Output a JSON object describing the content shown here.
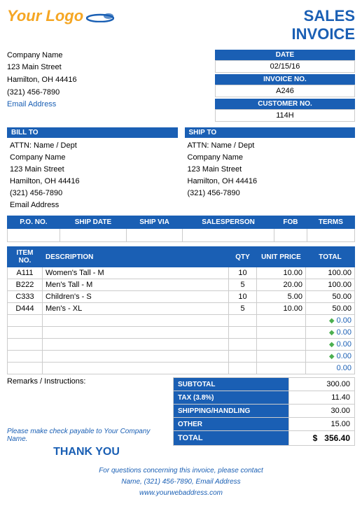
{
  "logo": {
    "text": "Your Logo",
    "swoosh_alt": "logo swoosh"
  },
  "invoice_title_line1": "SALES",
  "invoice_title_line2": "INVOICE",
  "sender": {
    "company": "Company Name",
    "street": "123 Main Street",
    "city": "Hamilton, OH  44416",
    "phone": "(321) 456-7890",
    "email": "Email Address"
  },
  "date_block": {
    "date_label": "DATE",
    "date_value": "02/15/16",
    "invoice_no_label": "INVOICE NO.",
    "invoice_no_value": "A246",
    "customer_no_label": "CUSTOMER NO.",
    "customer_no_value": "114H"
  },
  "bill_to": {
    "header": "BILL TO",
    "attn": "ATTN: Name / Dept",
    "company": "Company Name",
    "street": "123 Main Street",
    "city": "Hamilton, OH  44416",
    "phone": "(321) 456-7890",
    "email": "Email Address"
  },
  "ship_to": {
    "header": "SHIP TO",
    "attn": "ATTN: Name / Dept",
    "company": "Company Name",
    "street": "123 Main Street",
    "city": "Hamilton, OH  44416",
    "phone": "(321) 456-7890"
  },
  "po_row": {
    "headers": [
      "P.O. NO.",
      "SHIP DATE",
      "SHIP VIA",
      "SALESPERSON",
      "FOB",
      "TERMS"
    ],
    "values": [
      "",
      "",
      "",
      "",
      "",
      ""
    ]
  },
  "items_headers": [
    "ITEM NO.",
    "DESCRIPTION",
    "QTY",
    "UNIT PRICE",
    "TOTAL"
  ],
  "items": [
    {
      "item_no": "A111",
      "description": "Women's Tall - M",
      "qty": "10",
      "unit_price": "10.00",
      "total": "100.00"
    },
    {
      "item_no": "B222",
      "description": "Men's Tall - M",
      "qty": "5",
      "unit_price": "20.00",
      "total": "100.00"
    },
    {
      "item_no": "C333",
      "description": "Children's - S",
      "qty": "10",
      "unit_price": "5.00",
      "total": "50.00"
    },
    {
      "item_no": "D444",
      "description": "Men's - XL",
      "qty": "5",
      "unit_price": "10.00",
      "total": "50.00"
    }
  ],
  "empty_rows": 5,
  "remarks_label": "Remarks / Instructions:",
  "totals": {
    "subtotal_label": "SUBTOTAL",
    "subtotal_value": "300.00",
    "tax_label": "TAX (3.8%)",
    "tax_value": "11.40",
    "shipping_label": "SHIPPING/HANDLING",
    "shipping_value": "30.00",
    "other_label": "OTHER",
    "other_value": "15.00",
    "total_label": "TOTAL",
    "total_currency": "$",
    "total_value": "356.40"
  },
  "check_text": "Please make check payable to Your Company Name.",
  "thank_you": "THANK YOU",
  "footer": {
    "line1": "For questions concerning this invoice, please contact",
    "line2": "Name, (321) 456-7890, Email Address",
    "website": "www.yourwebaddress.com"
  }
}
